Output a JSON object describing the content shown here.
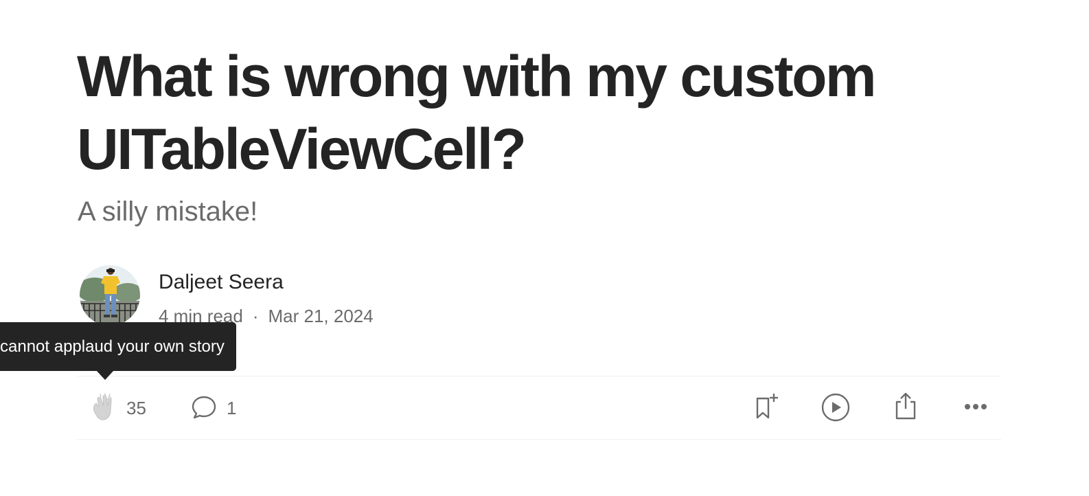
{
  "article": {
    "title": "What is wrong with my custom UITableViewCell?",
    "subtitle": "A silly mistake!"
  },
  "author": {
    "name": "Daljeet Seera",
    "read_time": "4 min read",
    "separator": "·",
    "date": "Mar 21, 2024"
  },
  "tooltip": {
    "text": "cannot applaud your own story"
  },
  "actions": {
    "clap_icon": "clap-icon",
    "clap_count": "35",
    "comment_icon": "comment-icon",
    "comment_count": "1",
    "bookmark_icon": "bookmark-add-icon",
    "listen_icon": "play-icon",
    "share_icon": "share-icon",
    "more_icon": "more-icon"
  },
  "colors": {
    "text_primary": "#242424",
    "text_secondary": "#6b6b6b",
    "tooltip_bg": "#242424",
    "divider": "#f0f0f0",
    "clap_disabled": "#c8c8c8"
  }
}
